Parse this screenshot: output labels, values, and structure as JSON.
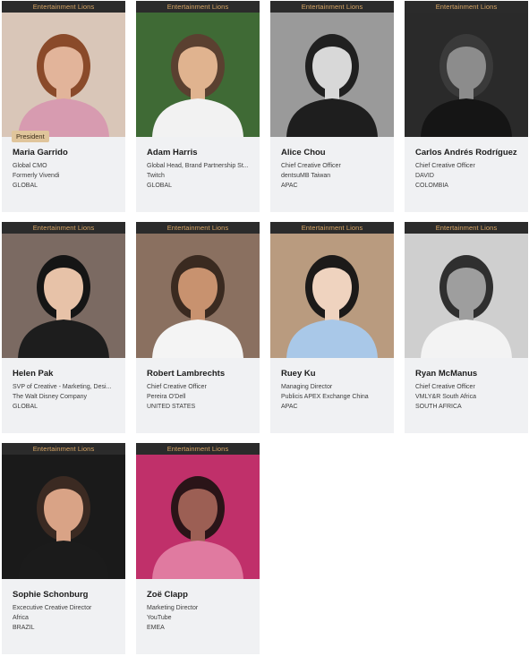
{
  "category_label": "Entertainment Lions",
  "badge_label": "President",
  "jurors": [
    {
      "name": "Maria Garrido",
      "title": "Global CMO",
      "company": "Formerly Vivendi",
      "region": "GLOBAL",
      "photo_bg": "#d9c6b8",
      "skin": "#e2b49a",
      "hair": "#8a4a2a",
      "cloth": "#d79bb0"
    },
    {
      "name": "Adam Harris",
      "title": "Global Head, Brand Partnership St...",
      "company": "Twitch",
      "region": "GLOBAL",
      "photo_bg": "#3f6a35",
      "skin": "#e0b38f",
      "hair": "#5a4030",
      "cloth": "#f2f2f2"
    },
    {
      "name": "Alice Chou",
      "title": "Chief Creative Officer",
      "company": "dentsuMB Taiwan",
      "region": "APAC",
      "photo_bg": "#9a9a9a",
      "skin": "#d8d8d8",
      "hair": "#202020",
      "cloth": "#1e1e1e"
    },
    {
      "name": "Carlos Andrés Rodríguez",
      "title": "Chief Creative Officer",
      "company": "DAVID",
      "region": "COLOMBIA",
      "photo_bg": "#2a2a2a",
      "skin": "#8c8c8c",
      "hair": "#3a3a3a",
      "cloth": "#151515"
    },
    {
      "name": "Helen Pak",
      "title": "SVP of Creative - Marketing, Desi...",
      "company": "The Walt Disney Company",
      "region": "GLOBAL",
      "photo_bg": "#7b6a62",
      "skin": "#e7c2a8",
      "hair": "#151515",
      "cloth": "#1d1d1d"
    },
    {
      "name": "Robert Lambrechts",
      "title": "Chief Creative Officer",
      "company": "Pereira O'Dell",
      "region": "UNITED STATES",
      "photo_bg": "#8a7060",
      "skin": "#c8926f",
      "hair": "#3a2a20",
      "cloth": "#f4f4f4"
    },
    {
      "name": "Ruey Ku",
      "title": "Managing Director",
      "company": "Publicis APEX Exchange China",
      "region": "APAC",
      "photo_bg": "#b99b7f",
      "skin": "#efd3bf",
      "hair": "#1c1a19",
      "cloth": "#a9c8e8"
    },
    {
      "name": "Ryan McManus",
      "title": "Chief Creative Officer",
      "company": "VMLY&R South Africa",
      "region": "SOUTH AFRICA",
      "photo_bg": "#cfcfcf",
      "skin": "#9e9e9e",
      "hair": "#2f2f2f",
      "cloth": "#f3f3f3"
    },
    {
      "name": "Sophie Schonburg",
      "title": "Excecutive Creative Director",
      "company": "Africa",
      "region": "BRAZIL",
      "photo_bg": "#1a1a1a",
      "skin": "#d9a386",
      "hair": "#3b2a22",
      "cloth": "#1b1b1b"
    },
    {
      "name": "Zoë Clapp",
      "title": "Marketing Director",
      "company": "YouTube",
      "region": "EMEA",
      "photo_bg": "#c0306a",
      "skin": "#9c5f54",
      "hair": "#2a1418",
      "cloth": "#e07aa0"
    }
  ]
}
